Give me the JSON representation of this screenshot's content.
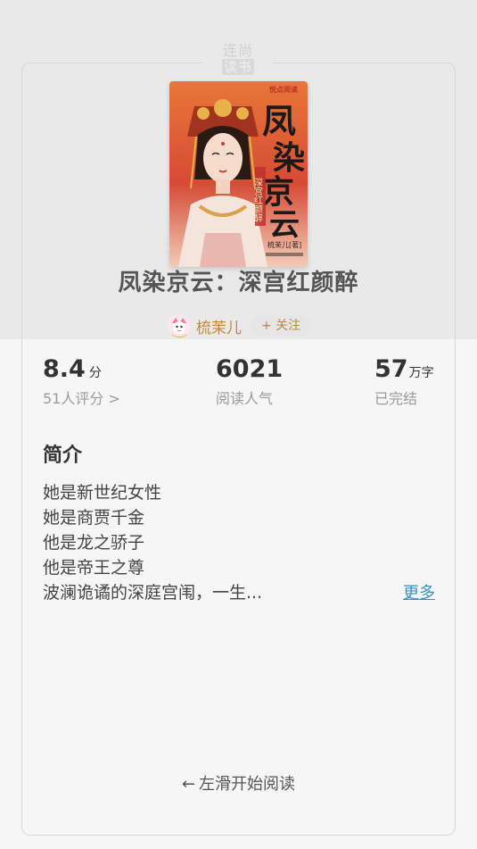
{
  "logo": {
    "line1": "连尚",
    "line2": "读书"
  },
  "book": {
    "title": "凤染京云：深宫红颜醉",
    "cover": {
      "publisher_badge": "悦点阅读",
      "title_chars": [
        "凤",
        "染",
        "京",
        "云"
      ],
      "subtitle": "深宫红颜醉",
      "author_line": "梳茉儿[著]"
    }
  },
  "author": {
    "name": "梳茉儿",
    "follow_label": "+ 关注"
  },
  "stats": {
    "rating": {
      "value": "8.4",
      "unit": "分",
      "label": "51人评分 >"
    },
    "popularity": {
      "value": "6021",
      "label": "阅读人气"
    },
    "words": {
      "value": "57",
      "unit": "万字",
      "label": "已完结"
    }
  },
  "intro": {
    "heading": "简介",
    "lines": [
      "她是新世纪女性",
      "她是商贾千金",
      "他是龙之骄子",
      "他是帝王之尊",
      "波澜诡谲的深庭宫闱，一生..."
    ],
    "more_label": "更多"
  },
  "footer": {
    "arrow": "←",
    "swipe_label": "左滑开始阅读"
  },
  "colors": {
    "author": "#c38a33",
    "link": "#3a8fbf",
    "cover_red": "#d94a2a"
  },
  "icons": {
    "avatar": "avatar-icon",
    "swipe": "left-arrow-icon"
  }
}
